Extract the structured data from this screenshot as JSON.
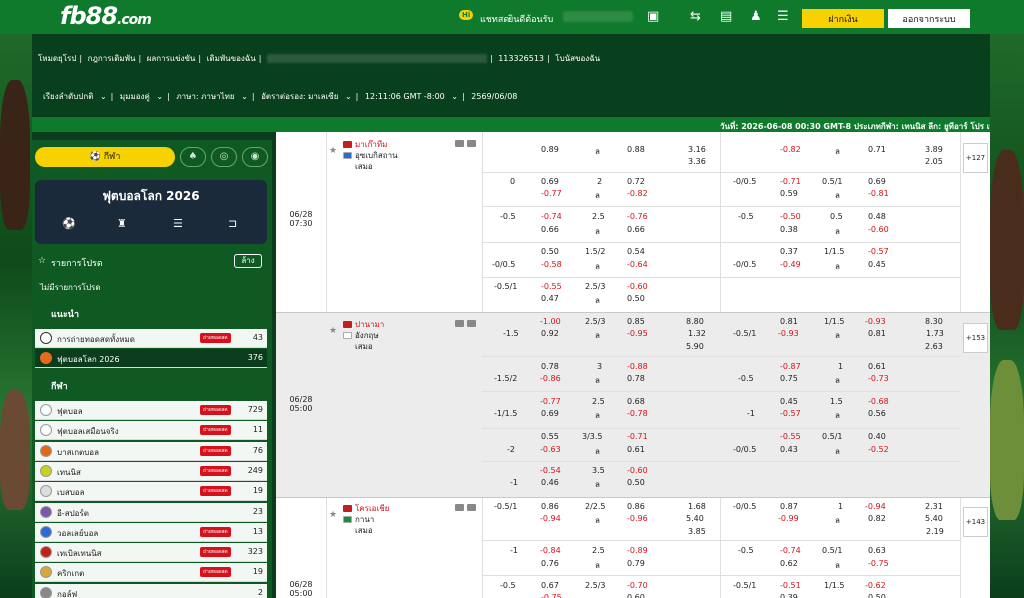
{
  "header": {
    "logo": "fb88",
    "logo_suffix": ".com",
    "hi_badge": "Hi",
    "chat_label": "แชทสด",
    "welcome_label": "ยินดีต้อนรับ",
    "deposit_label": "ฝากเงิน",
    "logout_label": "ออกจากระบบ"
  },
  "nav": {
    "items": [
      "โหมดยุโรป",
      "กฎการเดิมพัน",
      "ผลการแข่งขัน",
      "เดิมพันของฉัน"
    ],
    "account_id": "113326513",
    "bonus_label": "โบนัสของฉัน"
  },
  "settings": {
    "sort_label": "เรียงลำดับปกติ",
    "odds_label": "มุมมองคู่",
    "language_label": "ภาษา: ภาษาไทย",
    "odds_type_label": "อัตราต่อรอง: มาเลเซีย",
    "time_label": "12:11:06 GMT -8:00",
    "date_label": "2569/06/08"
  },
  "ticker": "วันที่: 2026-06-08 00:30 GMT-8 ประเภทกีฬา: เทนนิส ลีก: ยูทีอาร์ โปร เท",
  "sidebar": {
    "sport_tab": "กีฬา",
    "worldcup_title": "ฟุตบอลโลก 2026",
    "favorites_label": "รายการโปรด",
    "clear_label": "ล้าง",
    "no_favorites": "ไม่มีรายการโปรด",
    "recommended_label": "แนะนำ",
    "sports_label": "กีฬา",
    "recommended": [
      {
        "label": "การถ่ายทอดสดทั้งหมด",
        "count": "43",
        "live": "ถ่ายทอดสด"
      },
      {
        "label": "ฟุตบอลโลก 2026",
        "count": "376"
      }
    ],
    "sports": [
      {
        "label": "ฟุตบอล",
        "count": "729",
        "live": "ถ่ายทอดสด",
        "color": "#ffffff"
      },
      {
        "label": "ฟุตบอลเสมือนจริง",
        "count": "11",
        "live": "ถ่ายทอดสด",
        "color": "#ffffff"
      },
      {
        "label": "บาสเกตบอล",
        "count": "76",
        "live": "ถ่ายทอดสด",
        "color": "#e06a14"
      },
      {
        "label": "เทนนิส",
        "count": "249",
        "live": "ถ่ายทอดสด",
        "color": "#c9d11f"
      },
      {
        "label": "เบสบอล",
        "count": "19",
        "live": "ถ่ายทอดสด",
        "color": "#dddddd"
      },
      {
        "label": "อี-สปอร์ต",
        "count": "23",
        "color": "#7a5aa6"
      },
      {
        "label": "วอลเลย์บอล",
        "count": "13",
        "live": "ถ่ายทอดสด",
        "color": "#2c6bd3"
      },
      {
        "label": "เทเบิลเทนนิส",
        "count": "323",
        "live": "ถ่ายทอดสด",
        "color": "#c2201c"
      },
      {
        "label": "คริกเกต",
        "count": "19",
        "live": "ถ่ายทอดสด",
        "color": "#d8a93a"
      },
      {
        "label": "กอล์ฟ",
        "count": "2",
        "color": "#888888"
      }
    ]
  },
  "matches": [
    {
      "date": "06/28",
      "time": "07:30",
      "home": "มาเก๊าทีม",
      "away": "อุซเบกิสถาน",
      "draw": "เสมอ",
      "more": "+127"
    },
    {
      "date": "06/28",
      "time": "05:00",
      "home": "ปานามา",
      "away": "อังกฤษ",
      "draw": "เสมอ",
      "more": "+153"
    },
    {
      "date": "06/28",
      "time": "05:00",
      "home": "โครเอเชีย",
      "away": "กานา",
      "draw": "เสมอ",
      "more": "+143"
    }
  ]
}
